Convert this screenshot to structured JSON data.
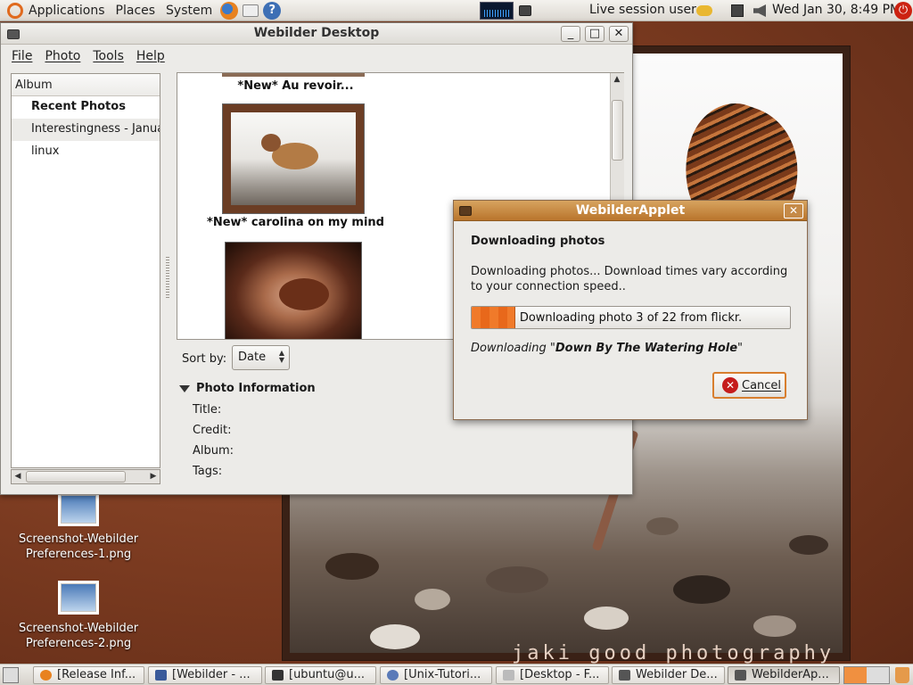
{
  "top_panel": {
    "menus": [
      "Applications",
      "Places",
      "System"
    ],
    "session_user": "Live session user",
    "clock": "Wed Jan 30,  8:49 PM"
  },
  "main_window": {
    "title": "Webilder Desktop",
    "menu": [
      "File",
      "Photo",
      "Tools",
      "Help"
    ],
    "album_header": "Album",
    "albums": [
      "Recent Photos",
      "Interestingness - January",
      "linux"
    ],
    "photos": [
      {
        "caption": "*New* Au revoir..."
      },
      {
        "caption": "*New* carolina on my mind"
      }
    ],
    "sort_label": "Sort by:",
    "sort_value": "Date",
    "info_header": "Photo Information",
    "info_fields": [
      "Title:",
      "Credit:",
      "Album:",
      "Tags:"
    ]
  },
  "dialog": {
    "title": "WebilderApplet",
    "heading": "Downloading photos",
    "message": "Downloading photos... Download times vary according to your connection speed..",
    "progress_text": "Downloading photo 3 of 22 from flickr.",
    "progress_fraction": 0.136,
    "downloading_prefix": "Downloading \"",
    "downloading_title": "Down By The Watering Hole",
    "downloading_suffix": "\"",
    "cancel_label": "Cancel"
  },
  "desktop": {
    "icons": [
      {
        "label": "Screenshot-Webilder Preferences-1.png"
      },
      {
        "label": "Screenshot-Webilder Preferences-2.png"
      }
    ],
    "watermark": "jaki good photography"
  },
  "taskbar": [
    {
      "label": "[Release Inf...",
      "active": false
    },
    {
      "label": "[Webilder - ...",
      "active": false
    },
    {
      "label": "[ubuntu@u...",
      "active": false
    },
    {
      "label": "[Unix-Tutori...",
      "active": false
    },
    {
      "label": "[Desktop - F...",
      "active": false
    },
    {
      "label": "Webilder De...",
      "active": false
    },
    {
      "label": "WebilderAp...",
      "active": true
    }
  ],
  "colors": {
    "accent_orange": "#e8681b",
    "dialog_titlebar": "#c58a48",
    "desktop_brown": "#7a3a20"
  }
}
